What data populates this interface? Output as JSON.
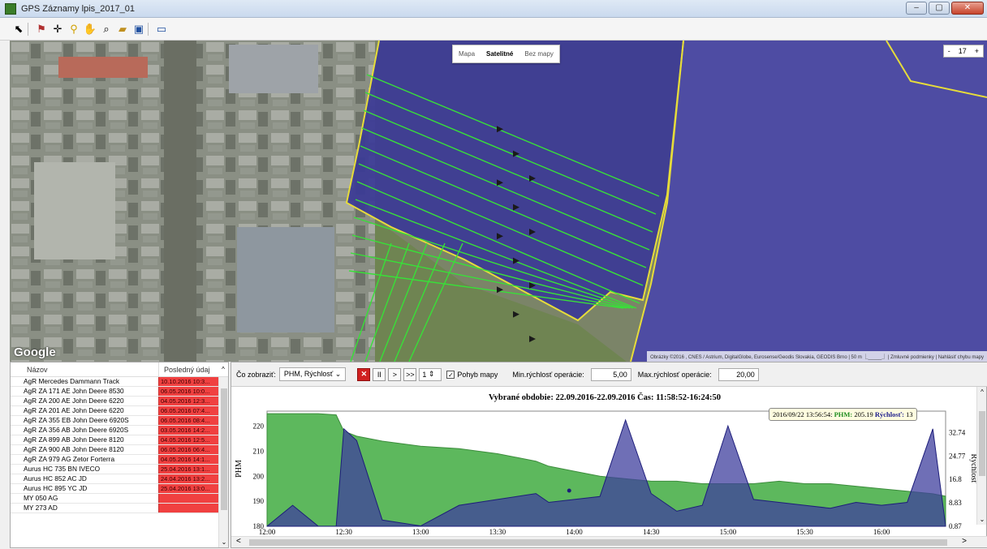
{
  "window": {
    "title": "GPS Záznamy lpis_2017_01",
    "controls": [
      "–",
      "▢",
      "✕"
    ]
  },
  "toolbar": {
    "icons": [
      "cursor-icon",
      "flag-icon",
      "crosshair-icon",
      "pin-icon",
      "hand-icon",
      "magnifier-icon",
      "folder-icon",
      "save-icon",
      "window-icon"
    ]
  },
  "map": {
    "types": [
      "Mapa",
      "Satelitné",
      "Bez mapy"
    ],
    "active_type": "Satelitné",
    "zoom_minus": "-",
    "zoom_level": "17",
    "zoom_plus": "+",
    "logo": "Google",
    "attribution": "Obrázky ©2016 , CNES / Astrium, DigitalGlobe, Eurosense/Geodis Slovakia, GEODIS Brno | 50 m ⎿_____⏌ | Zmluvné podmienky | Nahlásiť chybu mapy",
    "colors": {
      "field": "#3a3a9a",
      "track": "#38e038",
      "border": "#e8e040"
    }
  },
  "vehicles": {
    "header_name": "Názov",
    "header_last": "Posledný údaj",
    "rows": [
      {
        "name": "AgR Mercedes Dammann Track",
        "last": "10.10.2016 10:3..."
      },
      {
        "name": "AgR ZA 171 AE John Deere 8530",
        "last": "06.05.2016 10:0..."
      },
      {
        "name": "AgR ZA 200 AE John Deere 6220",
        "last": "04.05.2016 12:3..."
      },
      {
        "name": "AgR ZA 201 AE John Deere 6220",
        "last": "06.05.2016 07:4..."
      },
      {
        "name": "AgR ZA 355 EB John Deere 6920S",
        "last": "06.05.2016 08:4..."
      },
      {
        "name": "AgR ZA 356 AB John Deere 6920S",
        "last": "03.05.2016 14:2..."
      },
      {
        "name": "AgR ZA 899 AB John Deere 8120",
        "last": "04.05.2016 12:5..."
      },
      {
        "name": "AgR ZA 900 AB John Deere 8120",
        "last": "06.05.2016 06:4..."
      },
      {
        "name": "AgR ZA 979 AG Zetor Forterra",
        "last": "04.05.2016 14:1..."
      },
      {
        "name": "Aurus HC 735 BN IVECO",
        "last": "25.04.2016 13:1..."
      },
      {
        "name": "Aurus HC 852 AC JD",
        "last": "24.04.2016 13:2..."
      },
      {
        "name": "Aurus HC 895 YC JD",
        "last": "25.04.2016 13:0..."
      },
      {
        "name": "MY 050 AG",
        "last": ""
      },
      {
        "name": "MY 273 AD",
        "last": ""
      }
    ]
  },
  "controls": {
    "show_label": "Čo zobraziť:",
    "show_value": "PHM, Rýchlosť",
    "stop": "✕",
    "pause": "II",
    "next": ">",
    "fast": ">>",
    "step_value": "1",
    "move_map_label": "Pohyb mapy",
    "move_map_checked": "✓",
    "min_label": "Min.rýchlosť operácie:",
    "min_value": "5,00",
    "max_label": "Max.rýchlosť operácie:",
    "max_value": "20,00"
  },
  "chart_data": {
    "type": "area",
    "title": "Vybrané obdobie: 22.09.2016-22.09.2016 Čas: 11:58:52-16:24:50",
    "ylabel": "PHM",
    "y2label": "Rýchlosť",
    "ylim": [
      180,
      226
    ],
    "y2lim": [
      0.87,
      40
    ],
    "x_ticks": [
      "12:00",
      "12:30",
      "13:00",
      "13:30",
      "14:00",
      "14:30",
      "15:00",
      "15:30",
      "16:00"
    ],
    "y_ticks": [
      180,
      190,
      200,
      210,
      220
    ],
    "y2_ticks": [
      0.87,
      8.83,
      16.8,
      24.77,
      32.74
    ],
    "x_minutes": [
      0,
      10,
      20,
      27,
      30,
      35,
      45,
      60,
      75,
      90,
      105,
      110,
      120,
      130,
      140,
      150,
      160,
      170,
      180,
      190,
      200,
      210,
      220,
      230,
      240,
      250,
      260,
      265
    ],
    "series": [
      {
        "name": "PHM",
        "color": "#5db85d",
        "values": [
          225,
          225,
          225,
          224.5,
          218,
          216,
          214,
          212,
          211,
          209,
          206,
          204,
          202,
          200,
          199,
          198,
          198,
          197,
          197,
          197,
          198,
          197,
          197,
          196,
          195,
          194,
          193,
          192
        ]
      },
      {
        "name": "Rýchlosť",
        "color": "#3f3f9e",
        "values": [
          0.9,
          8,
          0.9,
          0.9,
          34,
          30,
          3,
          1,
          8,
          10,
          12,
          9,
          10,
          11,
          37,
          12,
          6,
          8,
          35,
          10,
          9,
          8,
          7,
          9,
          8,
          9,
          34,
          1
        ]
      }
    ],
    "tooltip": {
      "time": "2016/09/22 13:56:54:",
      "phm_label": "PHM:",
      "phm_value": "205.19",
      "speed_label": "Rýchlosť:",
      "speed_value": "13"
    }
  }
}
